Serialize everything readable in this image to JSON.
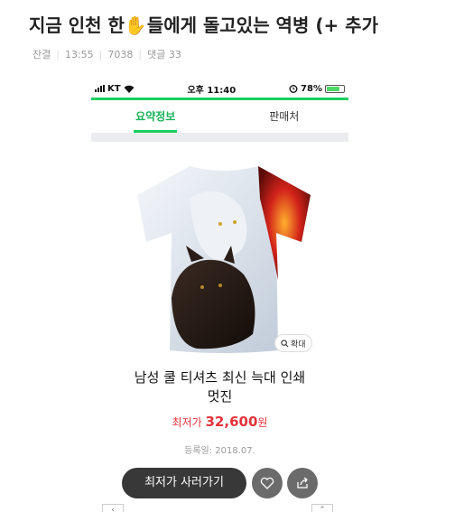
{
  "post": {
    "title": "지금 인천 한✋들에게 돌고있는 역병 (+ 추가",
    "author": "잔결",
    "time": "13:55",
    "views": "7038",
    "comments": "댓글 33"
  },
  "status_bar": {
    "carrier": "KT",
    "time": "오후 11:40",
    "battery": "78%",
    "battery_level": 0.78
  },
  "tabs": [
    {
      "label": "요약정보",
      "active": true
    },
    {
      "label": "판매처",
      "active": false
    }
  ],
  "product": {
    "name_line1": "남성 쿨 티셔츠 최신 늑대 인쇄",
    "name_line2": "멋진",
    "price_label": "최저가",
    "price_value": "32,600",
    "price_unit": "원",
    "registered": "등록일: 2018.07.",
    "zoom_label": "확대",
    "buy_label": "최저가 사러가기"
  },
  "colors": {
    "accent_green": "#19ce60",
    "price_red": "#e6333c",
    "button_dark": "#383838"
  },
  "icons": [
    "signal-icon",
    "wifi-icon",
    "alarm-icon",
    "battery-icon",
    "search-icon",
    "heart-icon",
    "share-icon",
    "chevron-up-icon"
  ]
}
